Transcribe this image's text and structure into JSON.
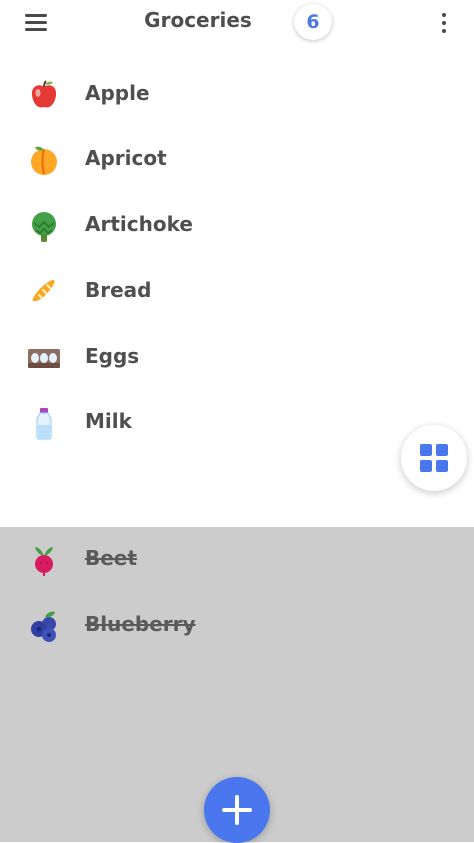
{
  "app": {
    "title": "Groceries",
    "count_badge": "6",
    "accent_color": "#4a77ee"
  },
  "active_items": [
    {
      "label": "Apple",
      "icon": "apple-icon"
    },
    {
      "label": "Apricot",
      "icon": "apricot-icon"
    },
    {
      "label": "Artichoke",
      "icon": "artichoke-icon"
    },
    {
      "label": "Bread",
      "icon": "bread-icon"
    },
    {
      "label": "Eggs",
      "icon": "eggs-icon"
    },
    {
      "label": "Milk",
      "icon": "milk-icon"
    }
  ],
  "completed_items": [
    {
      "label": "Beet",
      "icon": "beet-icon"
    },
    {
      "label": "Blueberry",
      "icon": "blueberry-icon"
    }
  ],
  "actions": {
    "menu_icon": "hamburger-menu-icon",
    "more_icon": "more-vertical-icon",
    "view_toggle_icon": "grid-view-icon",
    "add_icon": "plus-icon"
  }
}
